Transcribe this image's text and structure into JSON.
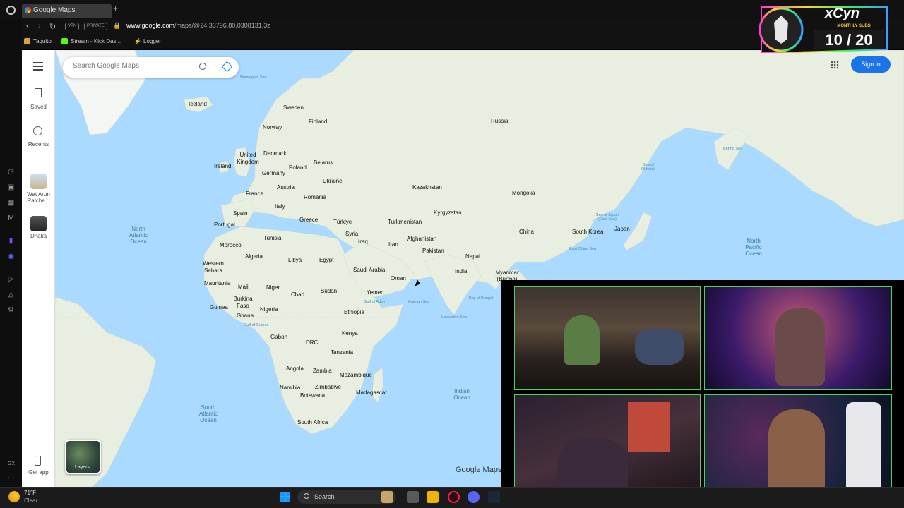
{
  "browser": {
    "tab_title": "Google Maps",
    "new_tab_symbol": "+",
    "url_domain": "www.google.com",
    "url_path": "/maps/@24.33796,80.0308131,3z",
    "vpn_badge": "VPN",
    "private_badge": "PRIVATE",
    "bookmarks": [
      {
        "label": "Taquito"
      },
      {
        "label": "Stream - Kick Das..."
      },
      {
        "label": "Logger"
      }
    ],
    "bottom_rail_label": "GX"
  },
  "maps": {
    "search_placeholder": "Search Google Maps",
    "sidebar": {
      "saved": "Saved",
      "recents": "Recents",
      "recent_place_1": "Wat Arun Ratcha...",
      "recent_place_2": "Dhaka",
      "get_app": "Get app"
    },
    "sign_in": "Sign in",
    "layers": "Layers",
    "logo": "Google Maps",
    "labels": {
      "norwegian_sea": "Norwegian Sea",
      "iceland": "Iceland",
      "sweden": "Sweden",
      "finland": "Finland",
      "norway": "Norway",
      "russia": "Russia",
      "united_kingdom": "United Kingdom",
      "denmark": "Denmark",
      "ireland": "Ireland",
      "belarus": "Belarus",
      "poland": "Poland",
      "germany": "Germany",
      "ukraine": "Ukraine",
      "france": "France",
      "austria": "Austria",
      "romania": "Romania",
      "italy": "Italy",
      "kazakhstan": "Kazakhstan",
      "mongolia": "Mongolia",
      "spain": "Spain",
      "portugal": "Portugal",
      "greece": "Greece",
      "turkiye": "Türkiye",
      "turkmenistan": "Turkmenistan",
      "kyrgyzstan": "Kyrgyzstan",
      "china": "China",
      "south_korea": "South Korea",
      "japan": "Japan",
      "north_atlantic": "North Atlantic Ocean",
      "tunisia": "Tunisia",
      "morocco": "Morocco",
      "syria": "Syria",
      "iraq": "Iraq",
      "iran": "Iran",
      "afghanistan": "Afghanistan",
      "pakistan": "Pakistan",
      "nepal": "Nepal",
      "algeria": "Algeria",
      "libya": "Libya",
      "egypt": "Egypt",
      "western_sahara": "Western Sahara",
      "saudi_arabia": "Saudi Arabia",
      "india": "India",
      "myanmar": "Myanmar (Burma)",
      "oman": "Oman",
      "mauritania": "Mauritania",
      "mali": "Mali",
      "niger": "Niger",
      "chad": "Chad",
      "sudan": "Sudan",
      "yemen": "Yemen",
      "burkina_faso": "Burkina Faso",
      "guinea": "Guinea",
      "nigeria": "Nigeria",
      "ghana": "Ghana",
      "ethiopia": "Ethiopia",
      "kenya": "Kenya",
      "gabon": "Gabon",
      "drc": "DRC",
      "tanzania": "Tanzania",
      "angola": "Angola",
      "zambia": "Zambia",
      "mozambique": "Mozambique",
      "namibia": "Namibia",
      "zimbabwe": "Zimbabwe",
      "botswana": "Botswana",
      "madagascar": "Madagascar",
      "south_africa": "South Africa",
      "south_atlantic": "South Atlantic Ocean",
      "indian_ocean": "Indian Ocean",
      "north_pacific": "North Pacific Ocean",
      "sea_of_okhotsk": "Sea of Okhotsk",
      "bering_sea": "Bering Sea",
      "sea_of_japan": "Sea of Japan (East Sea)",
      "east_china_sea": "East China Sea",
      "arabian_sea": "Arabian Sea",
      "bay_of_bengal": "Bay of Bengal",
      "gulf_of_aden": "Gulf of Aden",
      "gulf_of_guinea": "Gulf of Guinea",
      "laccadive_sea": "Laccadive Sea"
    }
  },
  "stream_overlay": {
    "brand": "xCyn",
    "subtitle": "MONTHLY SUBS",
    "sub_count": "10 / 20"
  },
  "taskbar": {
    "temperature": "71°F",
    "condition": "Clear",
    "search": "Search"
  },
  "colors": {
    "water": "#aadaff",
    "land": "#e8efe0",
    "accent": "#1a73e8",
    "cam_border": "#4cd35d"
  }
}
